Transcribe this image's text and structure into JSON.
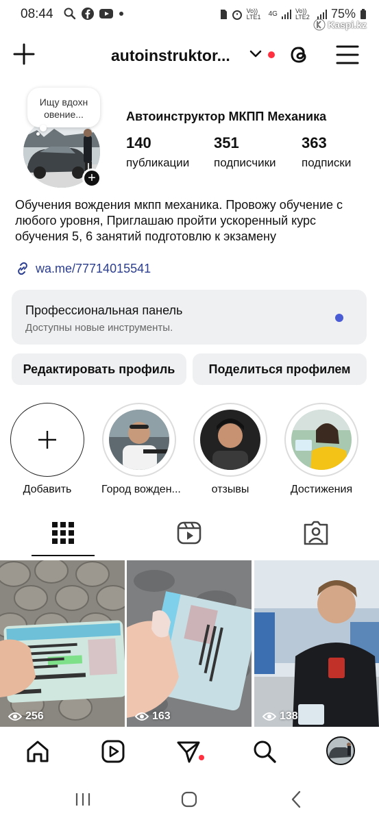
{
  "status_bar": {
    "time": "08:44",
    "battery": "75%",
    "network_labels": [
      "Vo)) LTE1",
      "4G",
      "Vo)) LTE2"
    ],
    "watermark": "Kaspi.kz"
  },
  "header": {
    "username": "autoinstruktor...",
    "icons": [
      "plus-icon",
      "chevron-down-icon",
      "threads-icon",
      "menu-icon"
    ],
    "notification_dot_color": "#ff3040"
  },
  "profile": {
    "note": "Ищу вдохновение...",
    "note_line1": "Ищу вдохн",
    "note_line2": "овение...",
    "display_name": "Автоинструктор МКПП Механика",
    "stats": [
      {
        "value": "140",
        "label": "публикации"
      },
      {
        "value": "351",
        "label": "подписчики"
      },
      {
        "value": "363",
        "label": "подписки"
      }
    ],
    "bio": "Обучения вождения мкпп механика. Провожу обучение с любого уровня, Приглашаю пройти ускоренный курс обучения 5, 6 занятий подготовлю к экзамену",
    "link": "wa.me/77714015541"
  },
  "pro_panel": {
    "title": "Профессиональная панель",
    "subtitle": "Доступны новые инструменты.",
    "dot_color": "#4a5bd6"
  },
  "buttons": {
    "edit_profile": "Редактировать профиль",
    "share_profile": "Поделиться профилем"
  },
  "highlights": [
    {
      "label": "Добавить"
    },
    {
      "label": "Город вожден..."
    },
    {
      "label": "отзывы"
    },
    {
      "label": "Достижения"
    }
  ],
  "tabs": [
    "grid-icon",
    "reels-icon",
    "tagged-icon"
  ],
  "posts": [
    {
      "views": "256"
    },
    {
      "views": "163"
    },
    {
      "views": "138"
    }
  ],
  "bottom_nav": [
    "home-icon",
    "reels-icon",
    "direct-icon",
    "search-icon",
    "profile-avatar"
  ],
  "system_nav": [
    "recent-apps-icon",
    "home-button-icon",
    "back-icon"
  ]
}
